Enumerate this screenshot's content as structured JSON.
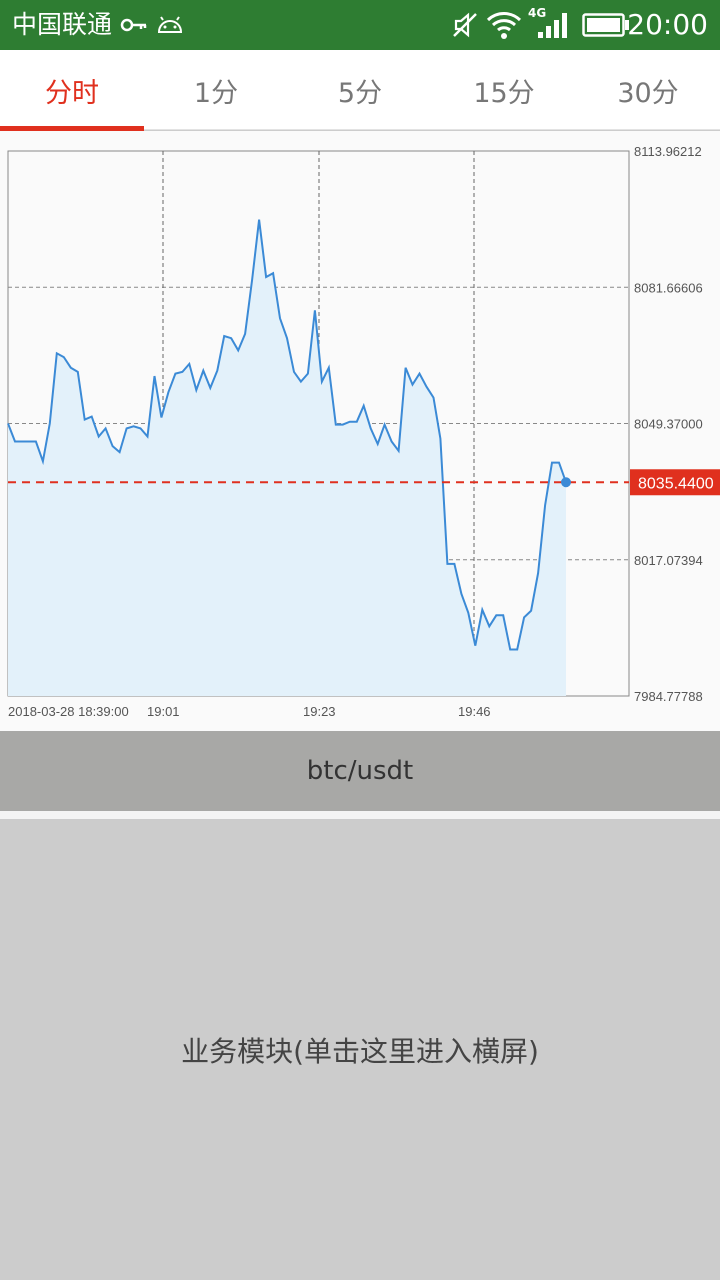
{
  "status_bar": {
    "carrier": "中国联通",
    "network": "4G",
    "time": "20:00",
    "icons": [
      "key-icon",
      "android-icon",
      "mute-icon",
      "wifi-icon",
      "signal-icon",
      "battery-icon"
    ]
  },
  "tabs": [
    {
      "label": "分时",
      "active": true
    },
    {
      "label": "1分",
      "active": false
    },
    {
      "label": "5分",
      "active": false
    },
    {
      "label": "15分",
      "active": false
    },
    {
      "label": "30分",
      "active": false
    }
  ],
  "chart_data": {
    "type": "area",
    "y_ticks": [
      "8113.96212",
      "8081.66606",
      "8049.37000",
      "8017.07394",
      "7984.77788"
    ],
    "ylim": [
      7984.77788,
      8113.96212
    ],
    "x_ticks": [
      "2018-03-28 18:39:00",
      "19:01",
      "19:23",
      "19:46"
    ],
    "current_price": "8035.4400",
    "colors": {
      "line": "#3b8ad6",
      "fill": "#e3f1fa",
      "current": "#e0301e"
    },
    "series": [
      {
        "values": [
          8049.37,
          8045.1,
          8045.1,
          8045.1,
          8045.1,
          8040.4,
          8049.4,
          8066.0,
          8065.1,
          8062.6,
          8061.6,
          8050.3,
          8051.0,
          8046.3,
          8048.2,
          8044.0,
          8042.6,
          8048.2,
          8048.7,
          8048.2,
          8046.3,
          8060.6,
          8050.8,
          8056.8,
          8061.2,
          8061.6,
          8063.5,
          8057.3,
          8061.9,
          8057.8,
          8061.9,
          8070.1,
          8069.6,
          8066.7,
          8070.6,
          8083.4,
          8097.7,
          8084.1,
          8085.0,
          8074.3,
          8069.6,
          8061.6,
          8059.3,
          8061.2,
          8076.2,
          8059.3,
          8062.6,
          8049.1,
          8049.1,
          8049.8,
          8049.8,
          8053.6,
          8048.2,
          8044.5,
          8049.1,
          8045.1,
          8042.9,
          8062.6,
          8058.6,
          8061.2,
          8058.1,
          8055.5,
          8045.8,
          8016.1,
          8016.1,
          8009.0,
          8004.5,
          7996.7,
          8005.2,
          8001.3,
          8003.9,
          8003.9,
          7995.8,
          7995.8,
          8003.4,
          8005.0,
          8013.9,
          8030.0,
          8040.1,
          8040.1,
          8035.44
        ]
      }
    ]
  },
  "pair_label": "btc/usdt",
  "module_label": "业务模块(单击这里进入横屏)"
}
